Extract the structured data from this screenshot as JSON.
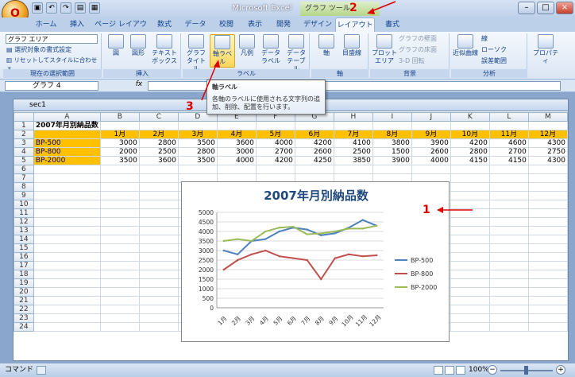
{
  "app": {
    "title": "Microsoft Excel",
    "context_tool_title": "グラフ ツール",
    "office_button_label": "O"
  },
  "tabs": [
    "ホーム",
    "挿入",
    "ページ レイアウト",
    "数式",
    "データ",
    "校閲",
    "表示",
    "開発",
    "デザイン",
    "レイアウト",
    "書式"
  ],
  "active_tab": "レイアウト",
  "ribbon": {
    "selection_group": {
      "dropdown_value": "グラフ エリア",
      "format_selection": "選択対象の書式設定",
      "reset_style": "リセットしてスタイルに合わせる",
      "label": "現在の選択範囲"
    },
    "insert_group": {
      "buttons": [
        "図",
        "図形",
        "テキスト ボックス"
      ],
      "label": "挿入"
    },
    "labels_group": {
      "buttons": [
        "グラフ タイトル",
        "軸ラベル",
        "凡例",
        "データ ラベル",
        "データ テーブル"
      ],
      "label": "ラベル"
    },
    "axes_group": {
      "buttons": [
        "軸",
        "目盛線"
      ],
      "label": "軸"
    },
    "background_group": {
      "buttons": [
        "プロット エリア"
      ],
      "small": [
        "グラフの壁面",
        "グラフの床面",
        "3-D 回転"
      ],
      "label": "背景"
    },
    "analysis_group": {
      "buttons": [
        "近似曲線"
      ],
      "small": [
        "線",
        "ローソク",
        "誤差範囲"
      ],
      "label": "分析"
    },
    "properties_button": "プロパティ"
  },
  "formula_bar": {
    "name_box": "グラフ 4",
    "fx": "fx",
    "formula": ""
  },
  "tooltip": {
    "title": "軸ラベル",
    "body": "各軸のラベルに使用される文字列の追加、削除、配置を行います。"
  },
  "workbook": {
    "title": "sec1"
  },
  "sheet": {
    "columns": [
      "A",
      "B",
      "C",
      "D",
      "E",
      "F",
      "G",
      "H",
      "I",
      "J",
      "K",
      "L",
      "M"
    ],
    "title_cell": "2007年月別納品数",
    "header_row": [
      "",
      "1月",
      "2月",
      "3月",
      "4月",
      "5月",
      "6月",
      "7月",
      "8月",
      "9月",
      "10月",
      "11月",
      "12月"
    ],
    "rows": [
      [
        "BP-500",
        "3000",
        "2800",
        "3500",
        "3600",
        "4000",
        "4200",
        "4100",
        "3800",
        "3900",
        "4200",
        "4600",
        "4300"
      ],
      [
        "BP-800",
        "2000",
        "2500",
        "2800",
        "3000",
        "2700",
        "2600",
        "2500",
        "1500",
        "2600",
        "2800",
        "2700",
        "2750"
      ],
      [
        "BP-2000",
        "3500",
        "3600",
        "3500",
        "4000",
        "4200",
        "4250",
        "3850",
        "3900",
        "4000",
        "4150",
        "4150",
        "4300"
      ]
    ],
    "row_numbers": [
      "1",
      "2",
      "3",
      "4",
      "5",
      "6",
      "7",
      "8",
      "9",
      "10",
      "11",
      "12",
      "13",
      "14",
      "15",
      "16",
      "17",
      "18",
      "19",
      "20",
      "21",
      "22",
      "23",
      "24"
    ]
  },
  "chart_data": {
    "type": "line",
    "title": "2007年月別納品数",
    "categories": [
      "1月",
      "2月",
      "3月",
      "4月",
      "5月",
      "6月",
      "7月",
      "8月",
      "9月",
      "10月",
      "11月",
      "12月"
    ],
    "series": [
      {
        "name": "BP-500",
        "color": "#4f81bd",
        "values": [
          3000,
          2800,
          3500,
          3600,
          4000,
          4200,
          4100,
          3800,
          3900,
          4200,
          4600,
          4300
        ]
      },
      {
        "name": "BP-800",
        "color": "#c0504d",
        "values": [
          2000,
          2500,
          2800,
          3000,
          2700,
          2600,
          2500,
          1500,
          2600,
          2800,
          2700,
          2750
        ]
      },
      {
        "name": "BP-2000",
        "color": "#9bbb59",
        "values": [
          3500,
          3600,
          3500,
          4000,
          4200,
          4250,
          3850,
          3900,
          4000,
          4150,
          4150,
          4300
        ]
      }
    ],
    "ylim": [
      0,
      5000
    ],
    "yticks": [
      "0",
      "500",
      "1000",
      "1500",
      "2000",
      "2500",
      "3000",
      "3500",
      "4000",
      "4500",
      "5000"
    ],
    "legend": "right",
    "grid": true
  },
  "annotations": [
    "1",
    "2",
    "3"
  ],
  "status": {
    "mode": "コマンド",
    "zoom": "100%"
  },
  "colors": {
    "accent": "#ffc000",
    "annotation": "#dd0000"
  }
}
